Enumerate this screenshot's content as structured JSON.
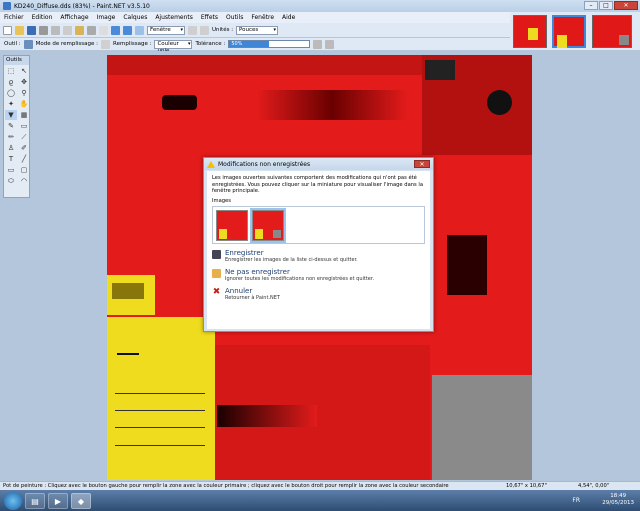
{
  "window": {
    "title": "KD240_Diffuse.dds (83%) - Paint.NET v3.5.10"
  },
  "menu": [
    "Fichier",
    "Edition",
    "Affichage",
    "Image",
    "Calques",
    "Ajustements",
    "Effets",
    "Outils",
    "Fenêtre",
    "Aide"
  ],
  "toolbar": {
    "zoom_mode": "Fenêtre",
    "units_label": "Unités :",
    "units_value": "Pouces"
  },
  "toolbar2": {
    "tool_label": "Outil :",
    "fill_mode_label": "Mode de remplissage :",
    "fill_label": "Remplissage :",
    "fill_value": "Couleur unie",
    "tolerance_label": "Tolérance :",
    "tolerance_text": "50%",
    "tolerance_value": 0.5
  },
  "tools_window": {
    "title": "Outils"
  },
  "dialog": {
    "title": "Modifications non enregistrées",
    "message": "Les images ouvertes suivantes comportent des modifications qui n'ont pas été enregistrées. Vous pouvez cliquer sur la miniature pour visualiser l'image dans la fenêtre principale.",
    "images_label": "Images",
    "options": [
      {
        "title": "Enregistrer",
        "desc": "Enregistrer les images de la liste ci-dessus et quitter.",
        "icon": "save-icon"
      },
      {
        "title": "Ne pas enregistrer",
        "desc": "Ignorer toutes les modifications non enregistrées et quitter.",
        "icon": "discard-icon"
      },
      {
        "title": "Annuler",
        "desc": "Retourner à Paint.NET",
        "icon": "cancel-icon"
      }
    ]
  },
  "status": {
    "text": "Pot de peinture : Cliquez avec le bouton gauche pour remplir la zone avec la couleur primaire ; cliquez avec le bouton droit pour remplir la zone avec la couleur secondaire",
    "size": "10,67\" x 10,67\"",
    "pos": "4,54\", 0,00\""
  },
  "taskbar": {
    "lang": "FR",
    "time": "18:49",
    "date": "29/05/2013"
  },
  "colors": {
    "texture_red": "#e31b1b",
    "texture_yellow": "#f0dc1e",
    "accent": "#3d86d8"
  }
}
